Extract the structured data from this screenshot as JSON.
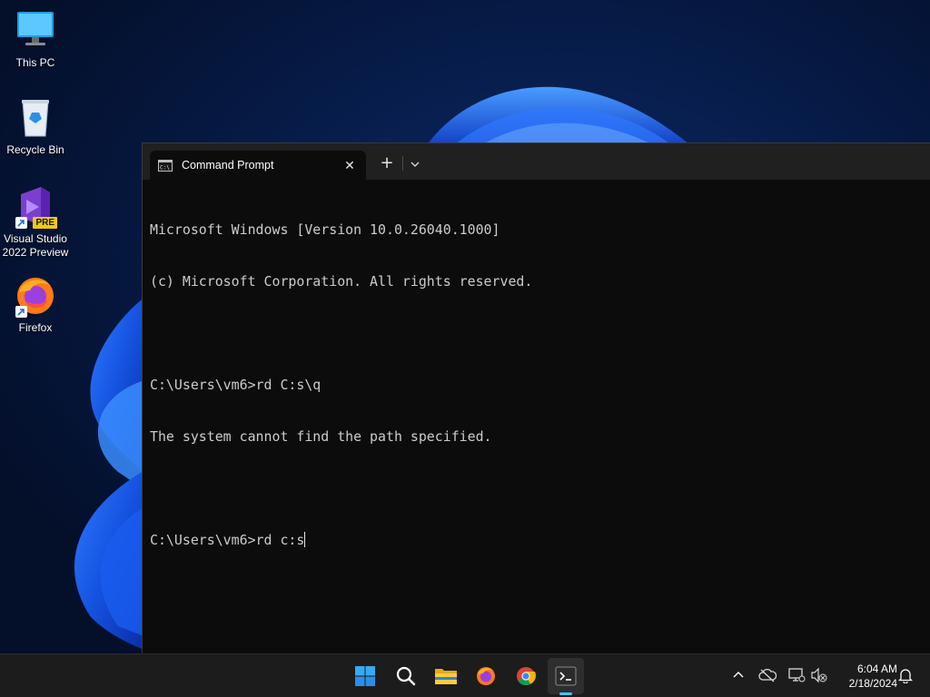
{
  "desktop": {
    "icons": [
      {
        "label": "This PC"
      },
      {
        "label": "Recycle Bin"
      },
      {
        "label": "Visual Studio 2022 Preview",
        "badge": "PRE"
      },
      {
        "label": "Firefox"
      }
    ]
  },
  "terminal": {
    "tab_title": "Command Prompt",
    "close_glyph": "✕",
    "new_tab_glyph": "+",
    "lines": [
      "Microsoft Windows [Version 10.0.26040.1000]",
      "(c) Microsoft Corporation. All rights reserved.",
      "",
      "C:\\Users\\vm6>rd C:s\\q",
      "The system cannot find the path specified.",
      "",
      "C:\\Users\\vm6>rd c:s"
    ],
    "colors": {
      "background": "#0c0c0c",
      "text": "#cccccc",
      "tabbar": "#202020"
    }
  },
  "taskbar": {
    "apps": [
      {
        "name": "start",
        "icon": "windows-logo-icon"
      },
      {
        "name": "search",
        "icon": "search-icon"
      },
      {
        "name": "file-explorer",
        "icon": "folder-icon"
      },
      {
        "name": "firefox",
        "icon": "firefox-icon"
      },
      {
        "name": "chrome",
        "icon": "chrome-icon"
      },
      {
        "name": "terminal",
        "icon": "terminal-icon",
        "active": true
      }
    ],
    "tray": {
      "icons": [
        "chevron-up-icon",
        "cloud-offline-icon",
        "network-icon",
        "volume-muted-icon",
        "notification-bell-icon"
      ],
      "time": "6:04 AM",
      "date": "2/18/2024"
    },
    "accent": "#4cc2ff"
  }
}
